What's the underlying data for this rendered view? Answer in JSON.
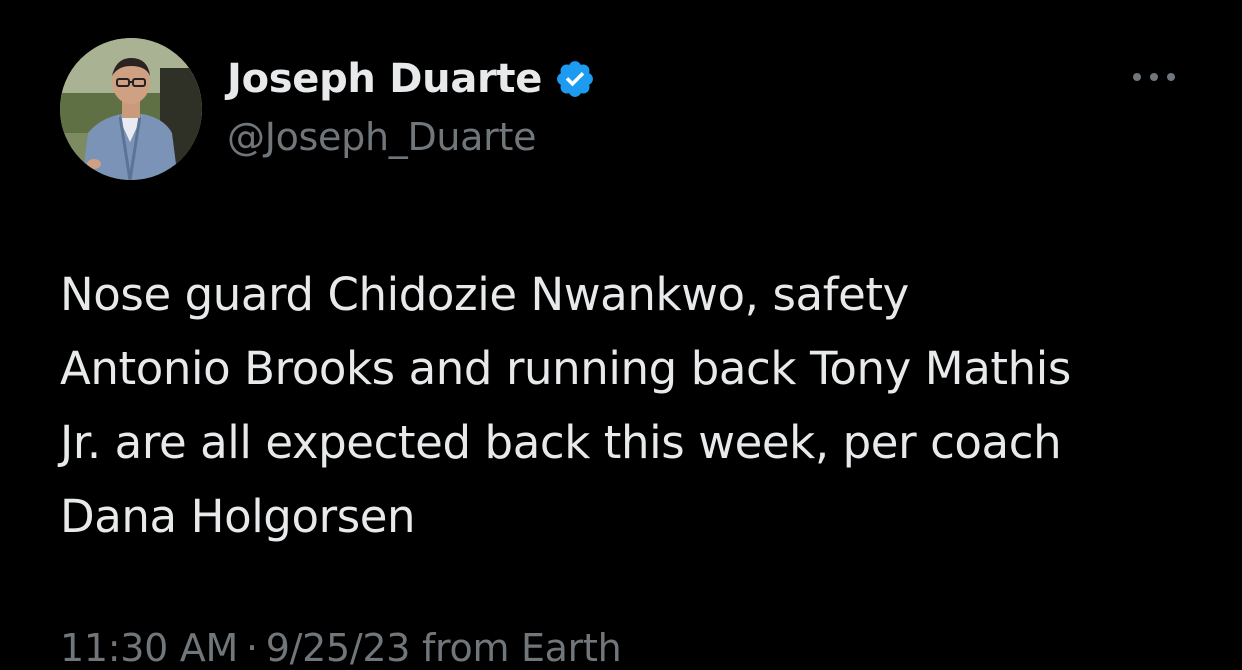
{
  "author": {
    "display_name": "Joseph Duarte",
    "handle": "@Joseph_Duarte",
    "verified": true,
    "avatar_icon": "profile-photo",
    "badge_color": "#1d9bf0"
  },
  "tweet": {
    "text_lines": [
      "Nose guard Chidozie Nwankwo, safety",
      "Antonio Brooks and running back Tony Mathis",
      "Jr. are all expected back this week, per coach",
      "Dana Holgorsen"
    ],
    "time": "11:30 AM",
    "separator": "·",
    "date": "9/25/23",
    "source": "from Earth"
  },
  "more_icon": "more-horizontal-icon",
  "colors": {
    "background": "#000000",
    "primary_text": "#e7e9ea",
    "secondary_text": "#71767b",
    "accent": "#1d9bf0"
  }
}
